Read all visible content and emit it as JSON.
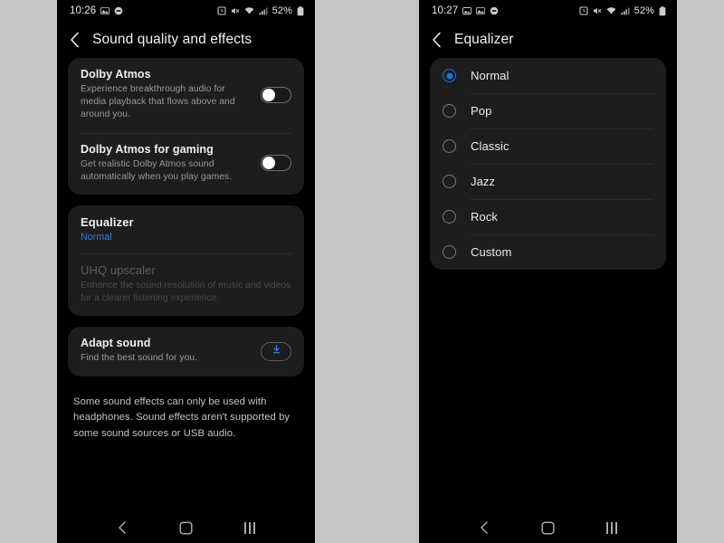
{
  "background_color": "#c6c6c6",
  "accent_color": "#1a73e8",
  "left_phone": {
    "status_bar": {
      "time": "10:26",
      "left_icons": [
        "image-icon",
        "record-icon"
      ],
      "right_icons": [
        "alarm-icon",
        "mute-icon",
        "wifi-icon",
        "signal-icon"
      ],
      "battery_percent": "52%",
      "battery_icon": "battery-icon"
    },
    "title": "Sound quality and effects",
    "back_icon": "back-chevron-icon",
    "cards": [
      {
        "rows": [
          {
            "title": "Dolby Atmos",
            "subtitle": "Experience breakthrough audio for media playback that flows above and around you.",
            "control": "toggle",
            "toggle_on": false
          },
          {
            "title": "Dolby Atmos for gaming",
            "subtitle": "Get realistic Dolby Atmos sound automatically when you play games.",
            "control": "toggle",
            "toggle_on": false
          }
        ]
      },
      {
        "rows": [
          {
            "title": "Equalizer",
            "subtitle": "Normal",
            "subtitle_accent": true,
            "control": "none"
          },
          {
            "title": "UHQ upscaler",
            "subtitle": "Enhance the sound resolution of music and videos for a clearer listening experience.",
            "disabled": true,
            "control": "none"
          }
        ]
      },
      {
        "rows": [
          {
            "title": "Adapt sound",
            "subtitle": "Find the best sound for you.",
            "control": "download",
            "control_icon": "download-icon"
          }
        ]
      }
    ],
    "footer_note": "Some sound effects can only be used with headphones. Sound effects aren't supported by some sound sources or USB audio.",
    "nav_bar": {
      "back": "nav-back-icon",
      "home": "nav-home-icon",
      "recents": "nav-recents-icon"
    }
  },
  "right_phone": {
    "status_bar": {
      "time": "10:27",
      "left_icons": [
        "photo-icon",
        "image-icon",
        "record-icon"
      ],
      "right_icons": [
        "alarm-icon",
        "mute-icon",
        "wifi-icon",
        "signal-icon"
      ],
      "battery_percent": "52%",
      "battery_icon": "battery-icon"
    },
    "title": "Equalizer",
    "back_icon": "back-chevron-icon",
    "options": [
      {
        "label": "Normal",
        "selected": true
      },
      {
        "label": "Pop",
        "selected": false
      },
      {
        "label": "Classic",
        "selected": false
      },
      {
        "label": "Jazz",
        "selected": false
      },
      {
        "label": "Rock",
        "selected": false
      },
      {
        "label": "Custom",
        "selected": false
      }
    ],
    "nav_bar": {
      "back": "nav-back-icon",
      "home": "nav-home-icon",
      "recents": "nav-recents-icon"
    }
  }
}
